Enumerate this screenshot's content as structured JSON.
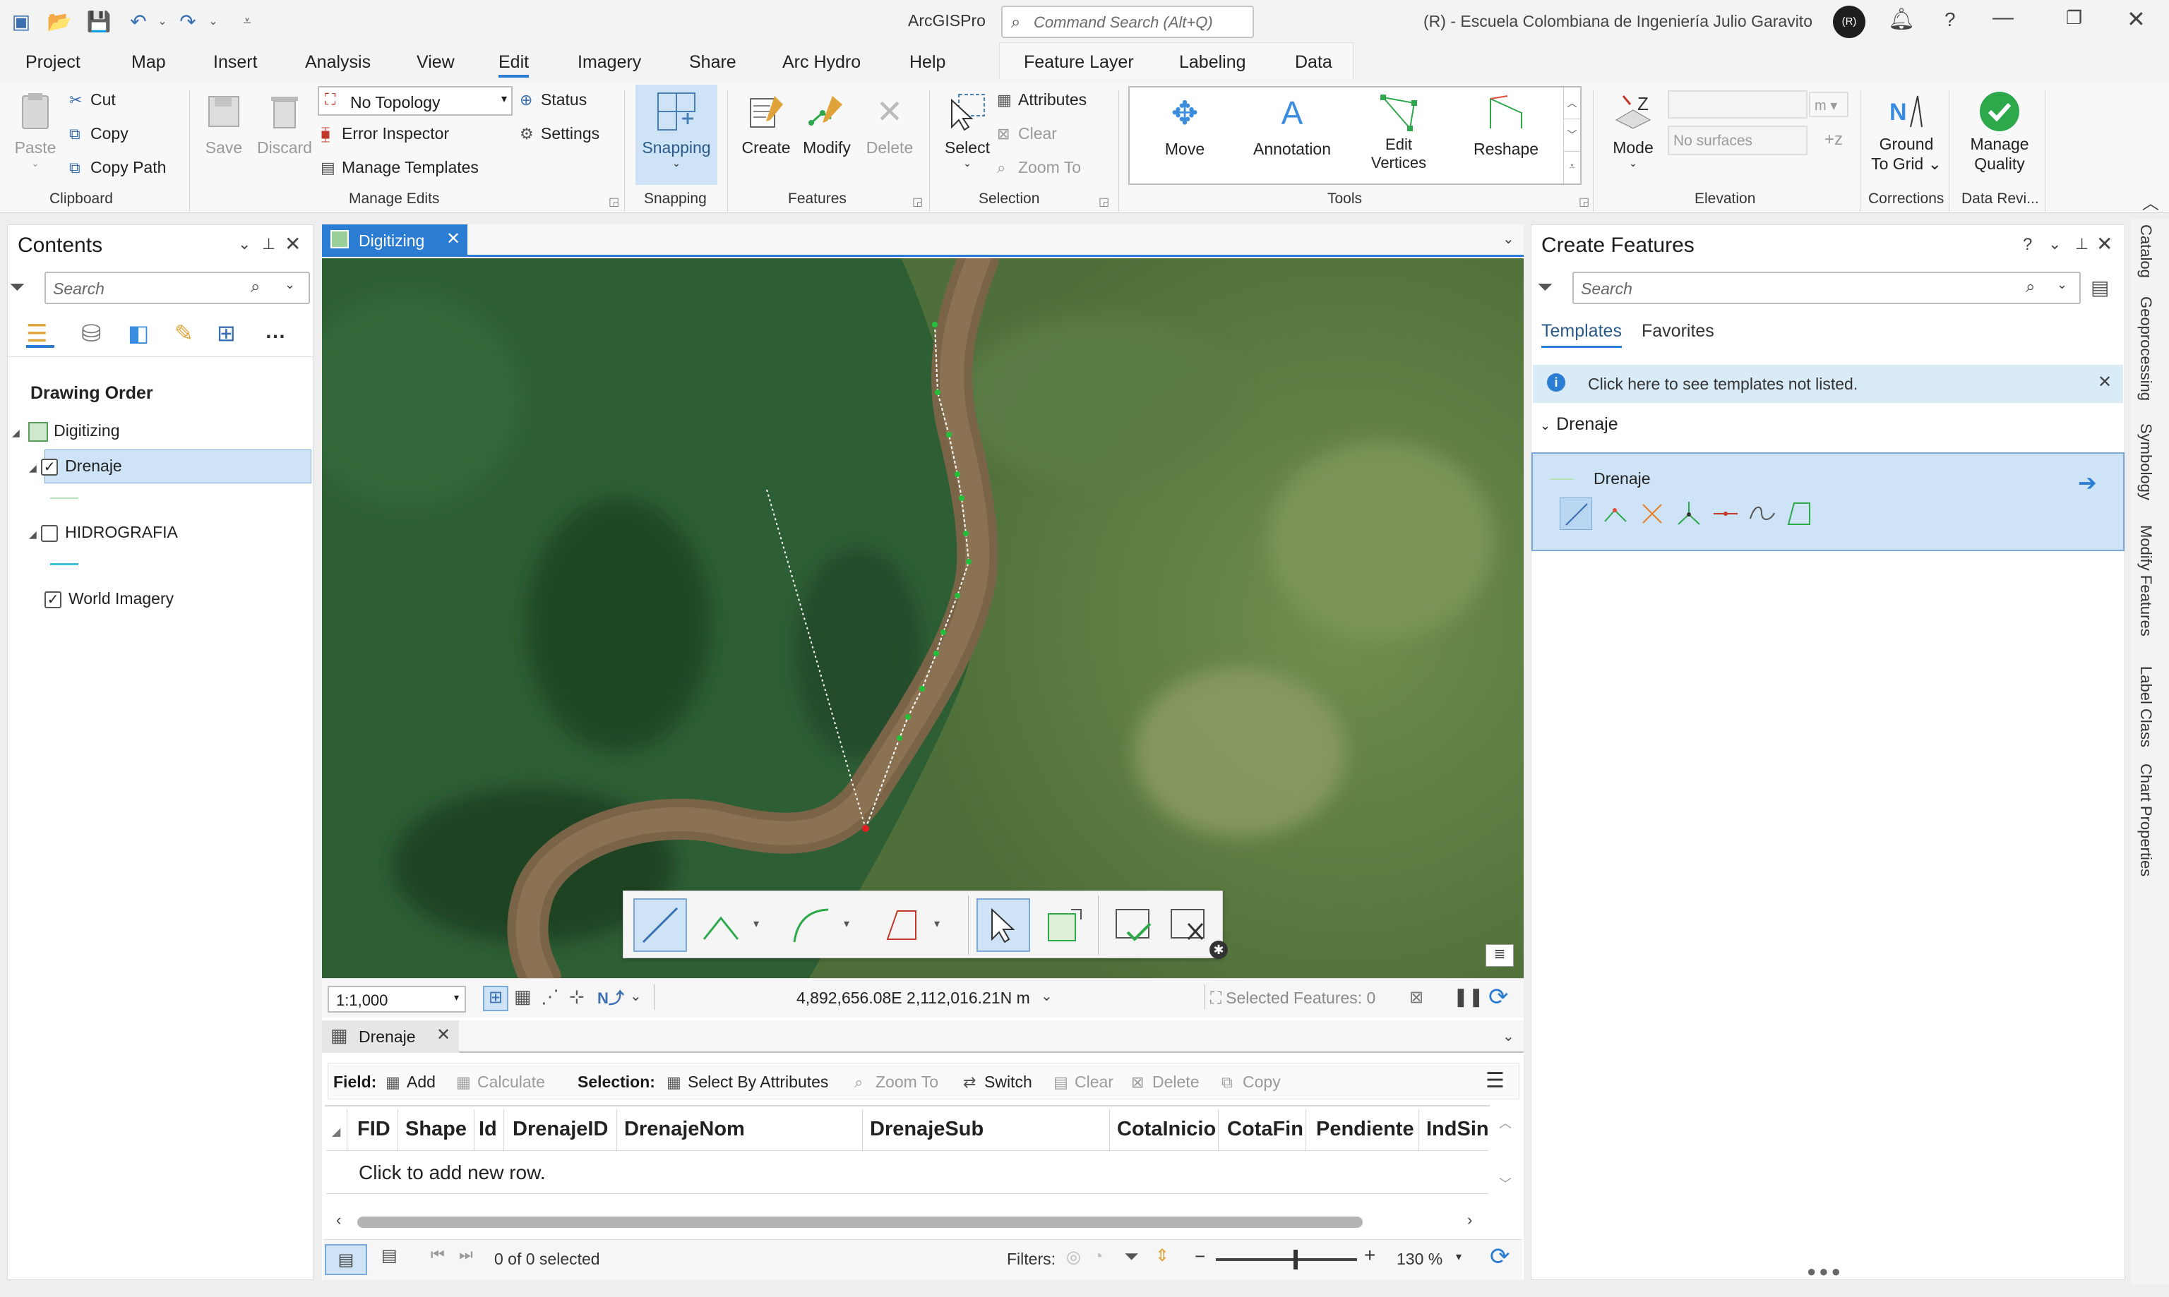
{
  "title_bar": {
    "app_title": "ArcGISPro",
    "command_search_placeholder": "Command Search (Alt+Q)",
    "org_name": "(R) - Escuela Colombiana de Ingeniería Julio Garavito",
    "user_initials": "(R)"
  },
  "menu_tabs": [
    "Project",
    "Map",
    "Insert",
    "Analysis",
    "View",
    "Edit",
    "Imagery",
    "Share",
    "Arc Hydro",
    "Help"
  ],
  "active_tab": "Edit",
  "context_tabs": [
    "Feature Layer",
    "Labeling",
    "Data"
  ],
  "ribbon": {
    "clipboard": {
      "paste": "Paste",
      "cut": "Cut",
      "copy": "Copy",
      "copy_path": "Copy Path",
      "label": "Clipboard"
    },
    "manage_edits": {
      "save": "Save",
      "discard": "Discard",
      "topology_value": "No Topology",
      "status": "Status",
      "error_inspector": "Error Inspector",
      "settings": "Settings",
      "manage_templates": "Manage Templates",
      "label": "Manage Edits"
    },
    "snapping": {
      "button": "Snapping",
      "label": "Snapping"
    },
    "features": {
      "create": "Create",
      "modify": "Modify",
      "delete": "Delete",
      "label": "Features"
    },
    "selection": {
      "select": "Select",
      "attributes": "Attributes",
      "clear": "Clear",
      "zoom_to": "Zoom To",
      "label": "Selection"
    },
    "tools": {
      "move": "Move",
      "annotation": "Annotation",
      "edit_vertices_1": "Edit",
      "edit_vertices_2": "Vertices",
      "reshape": "Reshape",
      "label": "Tools"
    },
    "elevation": {
      "mode": "Mode",
      "unit": "m",
      "surface_placeholder": "No surfaces",
      "label": "Elevation"
    },
    "corrections": {
      "ground_to_grid_1": "Ground",
      "ground_to_grid_2": "To Grid",
      "label": "Corrections"
    },
    "data_reviewer": {
      "manage_quality_1": "Manage",
      "manage_quality_2": "Quality",
      "label": "Data Revi..."
    }
  },
  "contents": {
    "title": "Contents",
    "search_placeholder": "Search",
    "heading": "Drawing Order",
    "map_name": "Digitizing",
    "layers": [
      {
        "name": "Drenaje",
        "checked": true,
        "selected": true,
        "swatch_color": "#b6e3b6"
      },
      {
        "name": "HIDROGRAFIA",
        "checked": false,
        "selected": false,
        "swatch_color": "#3ec3d6"
      },
      {
        "name": "World Imagery",
        "checked": true,
        "selected": false
      }
    ]
  },
  "map": {
    "tab_label": "Digitizing",
    "scale": "1:1,000",
    "coordinates": "4,892,656.08E 2,112,016.21N m",
    "selected_features": "Selected Features: 0"
  },
  "attribute_table": {
    "tab_label": "Drenaje",
    "field_label": "Field:",
    "add": "Add",
    "calculate": "Calculate",
    "selection_label": "Selection:",
    "select_by_attributes": "Select By Attributes",
    "zoom_to": "Zoom To",
    "switch": "Switch",
    "clear": "Clear",
    "delete": "Delete",
    "copy": "Copy",
    "columns": [
      "FID",
      "Shape",
      "Id",
      "DrenajeID",
      "DrenajeNom",
      "DrenajeSub",
      "CotaInicio",
      "CotaFin",
      "Pendiente",
      "IndSin"
    ],
    "new_row_text": "Click to add new row.",
    "selected_count": "0 of 0 selected",
    "filters_label": "Filters:",
    "zoom_level": "130 %"
  },
  "create_features": {
    "title": "Create Features",
    "search_placeholder": "Search",
    "tabs": [
      "Templates",
      "Favorites"
    ],
    "info_message": "Click here to see templates not listed.",
    "group_name": "Drenaje",
    "template_name": "Drenaje",
    "tools": [
      "line-icon",
      "polyline-vertex-icon",
      "intersect-icon",
      "trace-icon",
      "segment-icon",
      "freehand-icon",
      "right-angle-icon"
    ]
  },
  "side_tabs": [
    "Catalog",
    "Geoprocessing",
    "Symbology",
    "Modify Features",
    "Label Class",
    "Chart Properties"
  ],
  "colors": {
    "accent": "#2b7cd3",
    "selected_row": "#cfe3f7",
    "check_green": "#2da84a"
  }
}
